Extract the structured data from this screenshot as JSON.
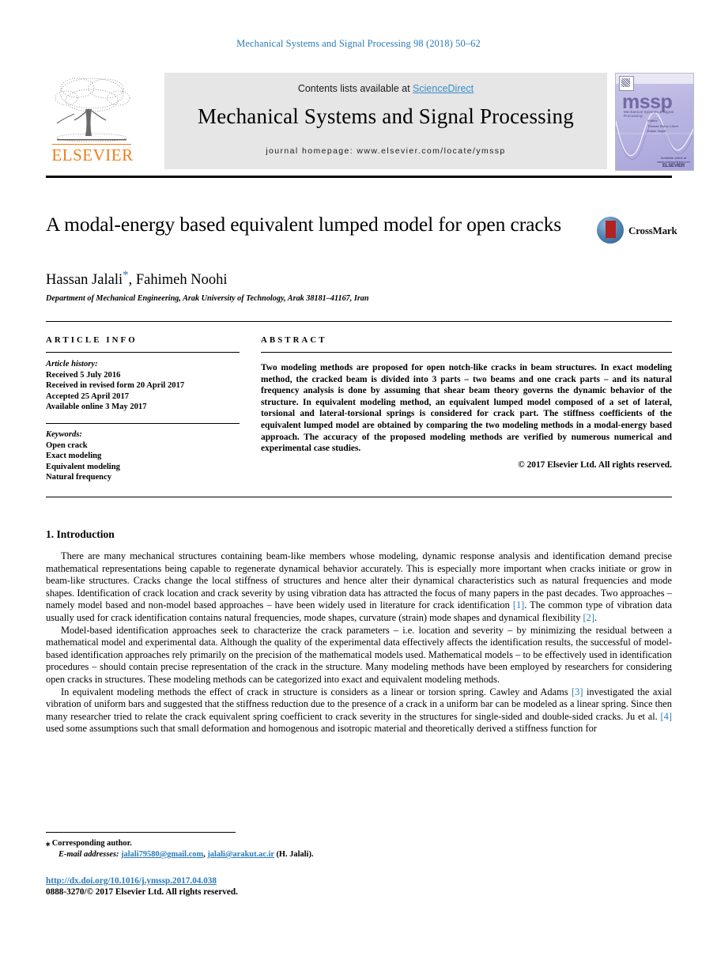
{
  "running_head": "Mechanical Systems and Signal Processing 98 (2018) 50–62",
  "masthead": {
    "publisher_name": "ELSEVIER",
    "contents_prefix": "Contents lists available at ",
    "contents_link": "ScienceDirect",
    "journal_title": "Mechanical Systems and Signal Processing",
    "homepage": "journal homepage: www.elsevier.com/locate/ymssp",
    "cover": {
      "acronym": "mssp",
      "subtitle": "Mechanical Systems & Signal Processing",
      "blurb_lines": [
        "Editors",
        "",
        "Thomas Sinha / Uhrer",
        "Kokon 'Anjini'"
      ],
      "bottom_note": "Available online at www.sciencedirect.com",
      "bottom_brand": "ELSEVIER"
    }
  },
  "article": {
    "title": "A modal-energy based equivalent lumped model for open cracks",
    "authors": "Hassan Jalali",
    "corresponding_marker": "*",
    "authors_rest": ", Fahimeh Noohi",
    "affiliation": "Department of Mechanical Engineering, Arak University of Technology, Arak 38181–41167, Iran",
    "crossmark_label": "CrossMark"
  },
  "info": {
    "heading": "ARTICLE INFO",
    "history_label": "Article history:",
    "history": [
      "Received 5 July 2016",
      "Received in revised form 20 April 2017",
      "Accepted 25 April 2017",
      "Available online 3 May 2017"
    ],
    "keywords_label": "Keywords:",
    "keywords": [
      "Open crack",
      "Exact modeling",
      "Equivalent modeling",
      "Natural frequency"
    ]
  },
  "abstract": {
    "heading": "ABSTRACT",
    "text": "Two modeling methods are proposed for open notch-like cracks in beam structures. In exact modeling method, the cracked beam is divided into 3 parts – two beams and one crack parts – and its natural frequency analysis is done by assuming that shear beam theory governs the dynamic behavior of the structure. In equivalent modeling method, an equivalent lumped model composed of a set of lateral, torsional and lateral-torsional springs is considered for crack part. The stiffness coefficients of the equivalent lumped model are obtained by comparing the two modeling methods in a modal-energy based approach. The accuracy of the proposed modeling methods are verified by numerous numerical and experimental case studies.",
    "copyright": "© 2017 Elsevier Ltd. All rights reserved."
  },
  "body": {
    "section_number_title": "1. Introduction",
    "paragraph_1_a": "There are many mechanical structures containing beam-like members whose modeling, dynamic response analysis and identification demand precise mathematical representations being capable to regenerate dynamical behavior accurately. This is especially more important when cracks initiate or grow in beam-like structures. Cracks change the local stiffness of structures and hence alter their dynamical characteristics such as natural frequencies and mode shapes. Identification of crack location and crack severity by using vibration data has attracted the focus of many papers in the past decades. Two approaches – namely model based and non-model based approaches – have been widely used in literature for crack identification ",
    "cite_1": "[1]",
    "paragraph_1_b": ". The common type of vibration data usually used for crack identification contains natural frequencies, mode shapes, curvature (strain) mode shapes and dynamical flexibility ",
    "cite_2": "[2]",
    "paragraph_1_c": ".",
    "paragraph_2": "Model-based identification approaches seek to characterize the crack parameters – i.e. location and severity – by minimizing the residual between a mathematical model and experimental data. Although the quality of the experimental data effectively affects the identification results, the successful of model-based identification approaches rely primarily on the precision of the mathematical models used. Mathematical models – to be effectively used in identification procedures – should contain precise representation of the crack in the structure. Many modeling methods have been employed by researchers for considering open cracks in structures. These modeling methods can be categorized into exact and equivalent modeling methods.",
    "paragraph_3_a": "In equivalent modeling methods the effect of crack in structure is considers as a linear or torsion spring. Cawley and Adams ",
    "cite_3": "[3]",
    "paragraph_3_b": " investigated the axial vibration of uniform bars and suggested that the stiffness reduction due to the presence of a crack in a uniform bar can be modeled as a linear spring. Since then many researcher tried to relate the crack equivalent spring coefficient to crack severity in the structures for single-sided and double-sided cracks. Ju et al. ",
    "cite_4": "[4]",
    "paragraph_3_c": " used some assumptions such that small deformation and homogenous and isotropic material and theoretically derived a stiffness function for"
  },
  "footer": {
    "corresponding_marker": "⁎",
    "corresponding_label": " Corresponding author.",
    "email_label": "E-mail addresses:",
    "email_1": "jalali79580@gmail.com",
    "email_separator": ", ",
    "email_2": "jalali@arakut.ac.ir",
    "email_suffix": " (H. Jalali).",
    "doi": "http://dx.doi.org/10.1016/j.ymssp.2017.04.038",
    "issn_line": "0888-3270/© 2017 Elsevier Ltd. All rights reserved."
  },
  "colors": {
    "link_blue": "#2b7bb9",
    "sciencedirect_blue": "#3a8ccc",
    "elsevier_orange": "#ef7d1a",
    "banner_gray": "#e6e6e6",
    "cover_purple": "#6f6aa6"
  }
}
